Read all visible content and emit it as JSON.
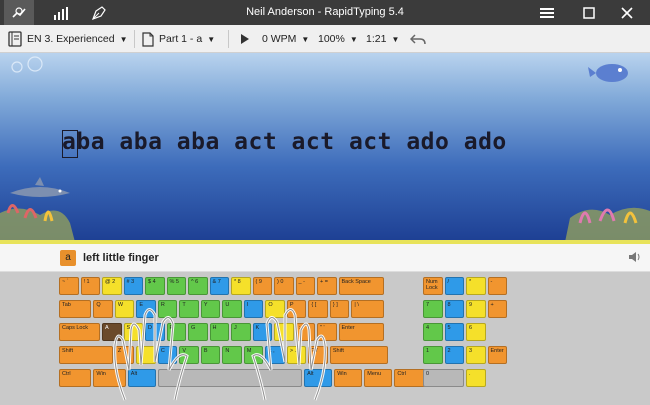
{
  "window": {
    "title": "Neil Anderson - RapidTyping 5.4",
    "left_icons": [
      "keyboard-tab-icon",
      "statistics-icon",
      "editor-icon"
    ],
    "controls": [
      "menu-icon",
      "maximize-icon",
      "close-icon"
    ]
  },
  "toolbar": {
    "course": "EN 3. Experienced",
    "lesson": "Part 1 - a",
    "speed": "0 WPM",
    "zoom": "100%",
    "time": "1:21"
  },
  "lesson": {
    "text": "aba aba aba act act act ado ado",
    "current_char": "a"
  },
  "hint": {
    "key": "a",
    "finger": "left little finger"
  },
  "keyboard": {
    "rows": [
      [
        {
          "t": "~ `",
          "c": "o"
        },
        {
          "t": "! 1",
          "c": "o"
        },
        {
          "t": "@ 2",
          "c": "y"
        },
        {
          "t": "# 3",
          "c": "b"
        },
        {
          "t": "$ 4",
          "c": "g"
        },
        {
          "t": "% 5",
          "c": "g"
        },
        {
          "t": "^ 6",
          "c": "g"
        },
        {
          "t": "& 7",
          "c": "b"
        },
        {
          "t": "* 8",
          "c": "y"
        },
        {
          "t": "( 9",
          "c": "o"
        },
        {
          "t": ") 0",
          "c": "o"
        },
        {
          "t": "_ -",
          "c": "o"
        },
        {
          "t": "+ =",
          "c": "o"
        },
        {
          "t": "Back Space",
          "c": "o"
        }
      ],
      [
        {
          "t": "Tab",
          "c": "o"
        },
        {
          "t": "Q",
          "c": "o"
        },
        {
          "t": "W",
          "c": "y"
        },
        {
          "t": "E",
          "c": "b"
        },
        {
          "t": "R",
          "c": "g"
        },
        {
          "t": "T",
          "c": "g"
        },
        {
          "t": "Y",
          "c": "g"
        },
        {
          "t": "U",
          "c": "g"
        },
        {
          "t": "I",
          "c": "b"
        },
        {
          "t": "O",
          "c": "y"
        },
        {
          "t": "P",
          "c": "o"
        },
        {
          "t": "{ [",
          "c": "o"
        },
        {
          "t": "} ]",
          "c": "o"
        },
        {
          "t": "| \\",
          "c": "o"
        }
      ],
      [
        {
          "t": "Caps Lock",
          "c": "o"
        },
        {
          "t": "A",
          "c": "br"
        },
        {
          "t": "S",
          "c": "y"
        },
        {
          "t": "D",
          "c": "b"
        },
        {
          "t": "F",
          "c": "g"
        },
        {
          "t": "G",
          "c": "g"
        },
        {
          "t": "H",
          "c": "g"
        },
        {
          "t": "J",
          "c": "g"
        },
        {
          "t": "K",
          "c": "b"
        },
        {
          "t": "L",
          "c": "y"
        },
        {
          "t": ": ;",
          "c": "o"
        },
        {
          "t": "\" '",
          "c": "o"
        },
        {
          "t": "Enter",
          "c": "o"
        }
      ],
      [
        {
          "t": "Shift",
          "c": "o"
        },
        {
          "t": "Z",
          "c": "o"
        },
        {
          "t": "X",
          "c": "y"
        },
        {
          "t": "C",
          "c": "b"
        },
        {
          "t": "V",
          "c": "g"
        },
        {
          "t": "B",
          "c": "g"
        },
        {
          "t": "N",
          "c": "g"
        },
        {
          "t": "M",
          "c": "g"
        },
        {
          "t": "< ,",
          "c": "b"
        },
        {
          "t": "> .",
          "c": "y"
        },
        {
          "t": "? /",
          "c": "o"
        },
        {
          "t": "Shift",
          "c": "o"
        }
      ],
      [
        {
          "t": "Ctrl",
          "c": "o"
        },
        {
          "t": "Win",
          "c": "o"
        },
        {
          "t": "Alt",
          "c": "b"
        },
        {
          "t": "",
          "c": "gr"
        },
        {
          "t": "Alt",
          "c": "b"
        },
        {
          "t": "Win",
          "c": "o"
        },
        {
          "t": "Menu",
          "c": "o"
        },
        {
          "t": "Ctrl",
          "c": "o"
        }
      ]
    ],
    "numpad": [
      [
        {
          "t": "Num Lock",
          "c": "o"
        },
        {
          "t": "/",
          "c": "b"
        },
        {
          "t": "*",
          "c": "y"
        },
        {
          "t": "-",
          "c": "o"
        }
      ],
      [
        {
          "t": "7",
          "c": "g"
        },
        {
          "t": "8",
          "c": "b"
        },
        {
          "t": "9",
          "c": "y"
        },
        {
          "t": "+",
          "c": "o"
        }
      ],
      [
        {
          "t": "4",
          "c": "g"
        },
        {
          "t": "5",
          "c": "b"
        },
        {
          "t": "6",
          "c": "y"
        }
      ],
      [
        {
          "t": "1",
          "c": "g"
        },
        {
          "t": "2",
          "c": "b"
        },
        {
          "t": "3",
          "c": "y"
        },
        {
          "t": "Enter",
          "c": "o"
        }
      ],
      [
        {
          "t": "0",
          "c": "gr"
        },
        {
          "t": ".",
          "c": "y"
        }
      ]
    ]
  },
  "colors": {
    "orange": "#f1952f",
    "yellow": "#f5e02a",
    "green": "#62c84a",
    "blue": "#2f9ae8",
    "accent": "#e8902c"
  }
}
